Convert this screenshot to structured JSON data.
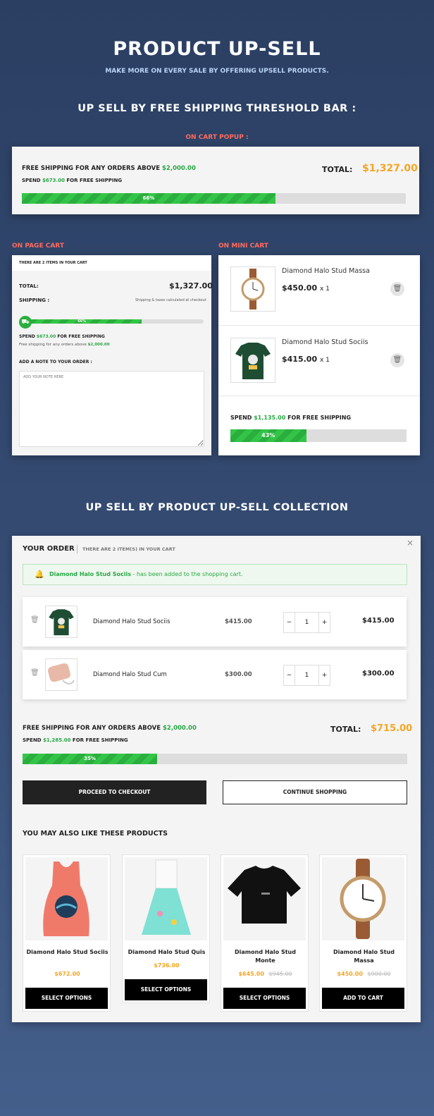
{
  "hero": {
    "title": "PRODUCT UP-SELL",
    "subtitle": "MAKE MORE ON EVERY SALE BY OFFERING UPSELL PRODUCTS."
  },
  "section1": {
    "title": "UP SELL BY FREE SHIPPING THRESHOLD BAR :",
    "popup_label": "ON CART POPUP :",
    "popup": {
      "free_text": "FREE SHIPPING FOR ANY ORDERS ABOVE",
      "free_amount": "$2,000.00",
      "spend_prefix": "SPEND",
      "spend_amount": "$673.00",
      "spend_suffix": "FOR FREE SHIPPING",
      "total_label": "TOTAL:",
      "total_value": "$1,327.00",
      "progress_label": "66%",
      "progress": 0.66
    }
  },
  "page_cart": {
    "label": "ON PAGE CART",
    "header": "THERE ARE 2 ITEMS IN YOUR CART",
    "total_label": "TOTAL:",
    "total_value": "$1,327.00",
    "shipping_label": "SHIPPING :",
    "shipping_note": "Shipping & taxes calculated at checkout",
    "progress_label": "66%",
    "progress": 0.66,
    "spend_prefix": "SPEND",
    "spend_amount": "$673.00",
    "spend_suffix": "FOR FREE SHIPPING",
    "free_note": "Free shipping for any orders above",
    "free_amount": "$2,000.00",
    "note_label": "ADD A NOTE TO YOUR ORDER :",
    "note_placeholder": "ADD YOUR NOTE HERE"
  },
  "mini_cart": {
    "label": "ON MINI CART",
    "items": [
      {
        "name": "Diamond Halo Stud Massa",
        "price": "$450.00",
        "qty": "x 1"
      },
      {
        "name": "Diamond Halo Stud Sociis",
        "price": "$415.00",
        "qty": "x 1"
      }
    ],
    "spend_prefix": "SPEND",
    "spend_amount": "$1,135.00",
    "spend_suffix": "FOR FREE SHIPPING",
    "progress_label": "43%",
    "progress": 0.43
  },
  "section2": {
    "title": "UP SELL BY PRODUCT UP-SELL COLLECTION"
  },
  "order": {
    "title": "YOUR ORDER",
    "count": "THERE ARE 2 ITEM(S) IN YOUR CART",
    "close": "×",
    "notice_product": "Diamond Halo Stud Sociis",
    "notice_text": "- has been added to the shopping cart.",
    "items": [
      {
        "name": "Diamond Halo Stud Sociis",
        "price": "$415.00",
        "qty": "1",
        "total": "$415.00"
      },
      {
        "name": "Diamond Halo Stud Cum",
        "price": "$300.00",
        "qty": "1",
        "total": "$300.00"
      }
    ],
    "free_text": "FREE SHIPPING FOR ANY ORDERS ABOVE",
    "free_amount": "$2,000.00",
    "spend_prefix": "SPEND",
    "spend_amount": "$1,285.00",
    "spend_suffix": "FOR FREE SHIPPING",
    "total_label": "TOTAL:",
    "total_value": "$715.00",
    "progress_label": "35%",
    "progress": 0.35,
    "checkout": "PROCEED TO CHECKOUT",
    "continue": "CONTINUE SHOPPING",
    "also_title": "YOU MAY ALSO LIKE THESE PRODUCTS",
    "products": [
      {
        "name": "Diamond Halo Stud Sociis",
        "price": "$672.00",
        "old_price": "",
        "button": "SELECT OPTIONS"
      },
      {
        "name": "Diamond Halo Stud Quis",
        "price": "$736.00",
        "old_price": "",
        "button": "SELECT OPTIONS"
      },
      {
        "name": "Diamond Halo Stud Monte",
        "price": "$645.00",
        "old_price": "$945.00",
        "button": "SELECT OPTIONS"
      },
      {
        "name": "Diamond Halo Stud Massa",
        "price": "$450.00",
        "old_price": "$900.00",
        "button": "ADD TO CART"
      }
    ]
  },
  "colors": {
    "accent_green": "#28a745",
    "price_orange": "#f5a623",
    "label_red": "#ff6b5d"
  }
}
